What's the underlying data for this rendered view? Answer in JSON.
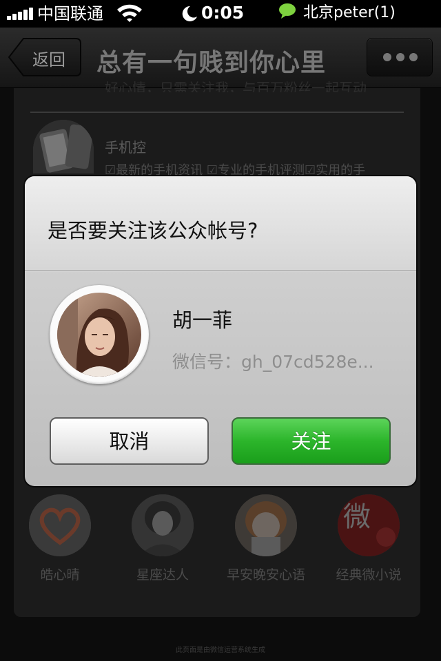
{
  "status_bar": {
    "carrier": "中国联通",
    "time": "0:05",
    "notification": "北京peter(1)"
  },
  "nav": {
    "back_label": "返回",
    "title": "总有一句贱到你心里",
    "more_icon": "more-icon"
  },
  "background": {
    "cut_text": "好心情，只需关注我，与百万粉丝一起互动",
    "item": {
      "name": "手机控",
      "description": "☑最新的手机资讯 ☑专业的手机评测☑实用的手"
    },
    "accounts": [
      {
        "name": "皓心晴"
      },
      {
        "name": "星座达人"
      },
      {
        "name": "早安晚安心语"
      },
      {
        "name": "经典微小说"
      }
    ],
    "footer": "此页面是由微信运营系统生成"
  },
  "dialog": {
    "question": "是否要关注该公众帐号?",
    "account_name": "胡一菲",
    "account_id": "微信号：gh_07cd528e...",
    "cancel_label": "取消",
    "follow_label": "关注",
    "colors": {
      "follow": "#2cb52b",
      "cancel": "#e8e8e8"
    }
  }
}
